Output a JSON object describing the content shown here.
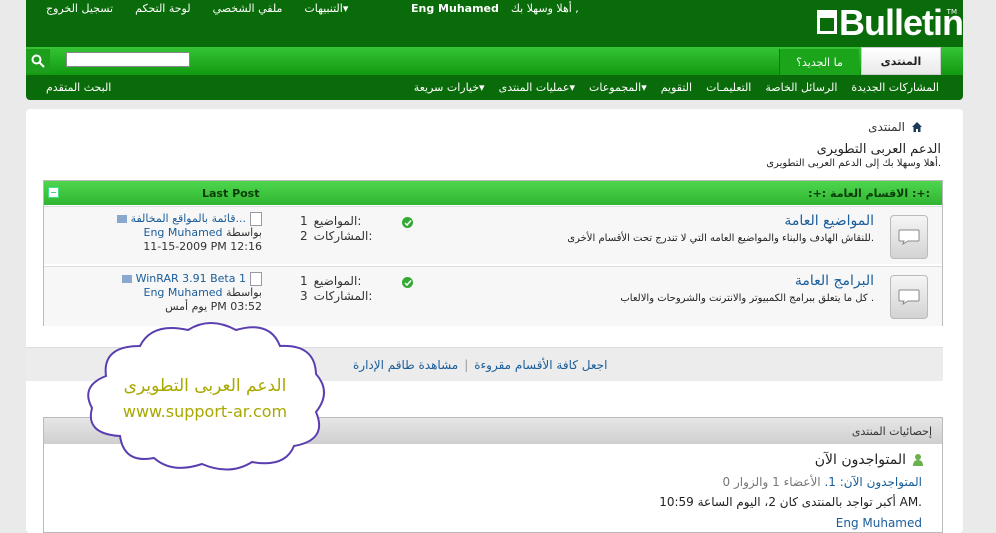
{
  "header": {
    "links": [
      "تسجيل الخروج",
      "لوحة التحكم",
      "ملفي الشخصي",
      "التنبيهات"
    ],
    "welcome_prefix": "أهلا وسهلا بك ,",
    "username": "Eng Muhamed",
    "logo_text": "Bulletin",
    "logo_tm": "TM"
  },
  "navbar": {
    "tab_forum": "المنتدى",
    "tab_new": "ما الجديد؟",
    "search_placeholder": ""
  },
  "subnav": {
    "items": [
      "المشاركات الجديدة",
      "الرسائل الخاصة",
      "التعليمـات",
      "التقويم",
      "المجموعات",
      "عمليات المنتدى",
      "خيارات سريعة"
    ],
    "advanced_search": "البحث المتقدم"
  },
  "breadcrumb": {
    "label": "المنتدى"
  },
  "page": {
    "title": "الدعم العربى التطويرى",
    "subtitle": "أهلا وسهلا بك إلى الدعم العربى التطويرى."
  },
  "category": {
    "title": ":+: الاقسام العامة :+:",
    "last_post_label": "Last Post",
    "collapse": "−"
  },
  "forums": [
    {
      "title": "المواضيع العامة",
      "description": "للنقاش الهادف والبناء والمواضيع العامه التي لا تندرج تحت الأقسام الأخرى.",
      "threads_label": "المواضيع:",
      "threads": "1",
      "posts_label": "المشاركات:",
      "posts": "2",
      "last_post_title": "قائمة بالمواقع المخالفة...",
      "by_label": "بواسطة",
      "last_post_user": "Eng Muhamed",
      "last_post_date": "11-15-2009 PM 12:16"
    },
    {
      "title": "البرامج العامة",
      "description": "كل ما يتعلق ببرامج الكمبيوتر والانترنت والشروحات والالعاب .",
      "threads_label": "المواضيع:",
      "threads": "1",
      "posts_label": "المشاركات:",
      "posts": "3",
      "last_post_title": "WinRAR 3.91 Beta 1",
      "by_label": "بواسطة",
      "last_post_user": "Eng Muhamed",
      "last_post_date": "يوم أمس PM 03:52"
    }
  ],
  "bottom": {
    "mark_read": "اجعل كافة الأقسام مقروءة",
    "separator": "|",
    "view_staff": "مشاهدة طاقم الإدارة"
  },
  "stats": {
    "title": "إحصائيات المنتدى",
    "online_heading": "المتواجدون الآن",
    "online_line_prefix": "المتواجدون الآن: 1.",
    "online_line_detail": "الأعضاء 1 والزوار 0",
    "max_online": "أكبر تواجد بالمنتدى كان 2، اليوم الساعة 10:59 AM.",
    "online_user": "Eng Muhamed"
  },
  "watermark": {
    "line1": "الدعم العربى التطويرى",
    "line2": "www.support-ar.com"
  },
  "colors": {
    "header": "#0a6b0a",
    "nav": "#129a12",
    "link": "#1a5d9a",
    "watermark": "#a8a800"
  }
}
